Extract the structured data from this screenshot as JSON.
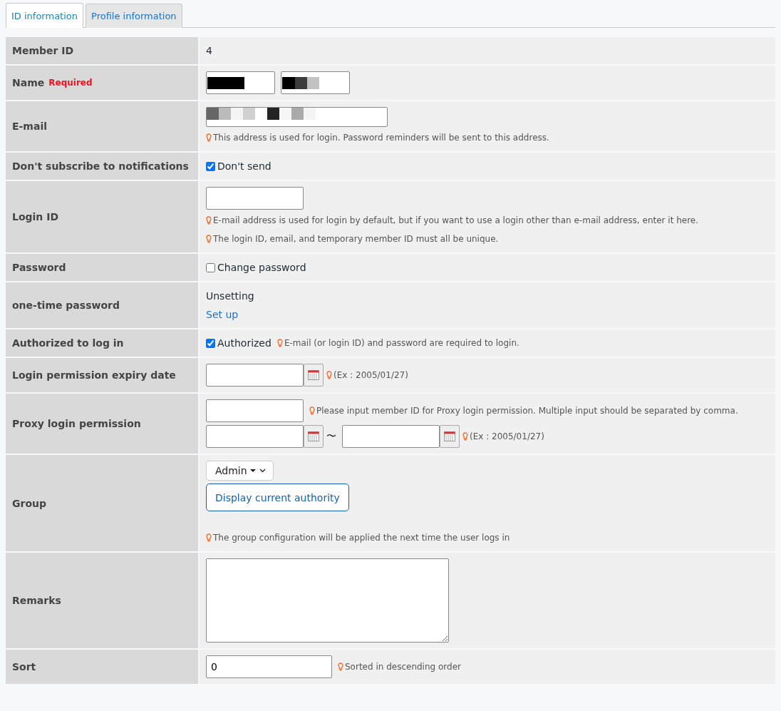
{
  "tabs": [
    {
      "label": "ID information",
      "selected": true
    },
    {
      "label": "Profile information",
      "selected": false
    }
  ],
  "rows": [
    {
      "label": "Member ID",
      "lines": [
        [
          {
            "kind": "text",
            "text": "4"
          }
        ]
      ]
    },
    {
      "label": "Name",
      "required": "Required",
      "lines": [
        [
          {
            "kind": "redacted-name"
          },
          {
            "kind": "redacted-name"
          }
        ]
      ]
    },
    {
      "label": "E-mail",
      "lines": [
        [
          {
            "kind": "redacted-email"
          }
        ],
        [
          {
            "kind": "hint",
            "text": "This address is used for login. Password reminders will be sent to this address."
          }
        ]
      ]
    },
    {
      "label": "Don't subscribe to notifications",
      "lines": [
        [
          {
            "kind": "checkbox",
            "text": "Don't send",
            "checked": true
          }
        ]
      ]
    },
    {
      "label": "Login ID",
      "lines": [
        [
          {
            "kind": "field"
          }
        ],
        [
          {
            "kind": "hint",
            "text": "E-mail address is used for login by default, but if you want to use a login other than e-mail address, enter it here."
          }
        ],
        [
          {
            "kind": "hint",
            "text": "The login ID, email, and temporary member ID must all be unique."
          }
        ]
      ]
    },
    {
      "label": "Password",
      "lines": [
        [
          {
            "kind": "checkbox",
            "text": "Change password",
            "checked": false
          }
        ]
      ]
    },
    {
      "label": "one-time password",
      "lines": [
        [
          {
            "kind": "text",
            "text": "Unsetting"
          }
        ],
        [
          {
            "kind": "link",
            "text": "Set up"
          }
        ]
      ]
    },
    {
      "label": "Authorized to log in",
      "lines": [
        [
          {
            "kind": "checkbox",
            "text": "Authorized",
            "checked": true
          },
          {
            "kind": "hint",
            "text": "E-mail (or login ID) and password are required to login."
          }
        ]
      ]
    },
    {
      "label": "Login permission expiry date",
      "lines": [
        [
          {
            "kind": "date"
          },
          {
            "kind": "hint",
            "text": "(Ex : 2005/01/27)"
          }
        ]
      ]
    },
    {
      "label": "Proxy login permission",
      "lines": [
        [
          {
            "kind": "field"
          },
          {
            "kind": "hint",
            "text": "Please input member ID for Proxy login permission. Multiple input should be separated by comma."
          }
        ],
        [
          {
            "kind": "date"
          },
          {
            "kind": "text",
            "text": "〜"
          },
          {
            "kind": "date"
          },
          {
            "kind": "hint",
            "text": "(Ex : 2005/01/27)"
          }
        ]
      ]
    },
    {
      "label": "Group",
      "lines": [
        [
          {
            "kind": "select",
            "text": "Admin"
          }
        ],
        [
          {
            "kind": "button",
            "text": "Display current authority"
          }
        ],
        [
          {
            "kind": "hint",
            "text": "The group configuration will be applied the next time the user logs in"
          }
        ]
      ]
    },
    {
      "label": "Remarks",
      "lines": [
        [
          {
            "kind": "textarea"
          }
        ]
      ]
    },
    {
      "label": "Sort",
      "lines": [
        [
          {
            "kind": "wide-field",
            "value": "0"
          },
          {
            "kind": "hint",
            "text": "Sorted in descending order"
          }
        ]
      ]
    }
  ]
}
